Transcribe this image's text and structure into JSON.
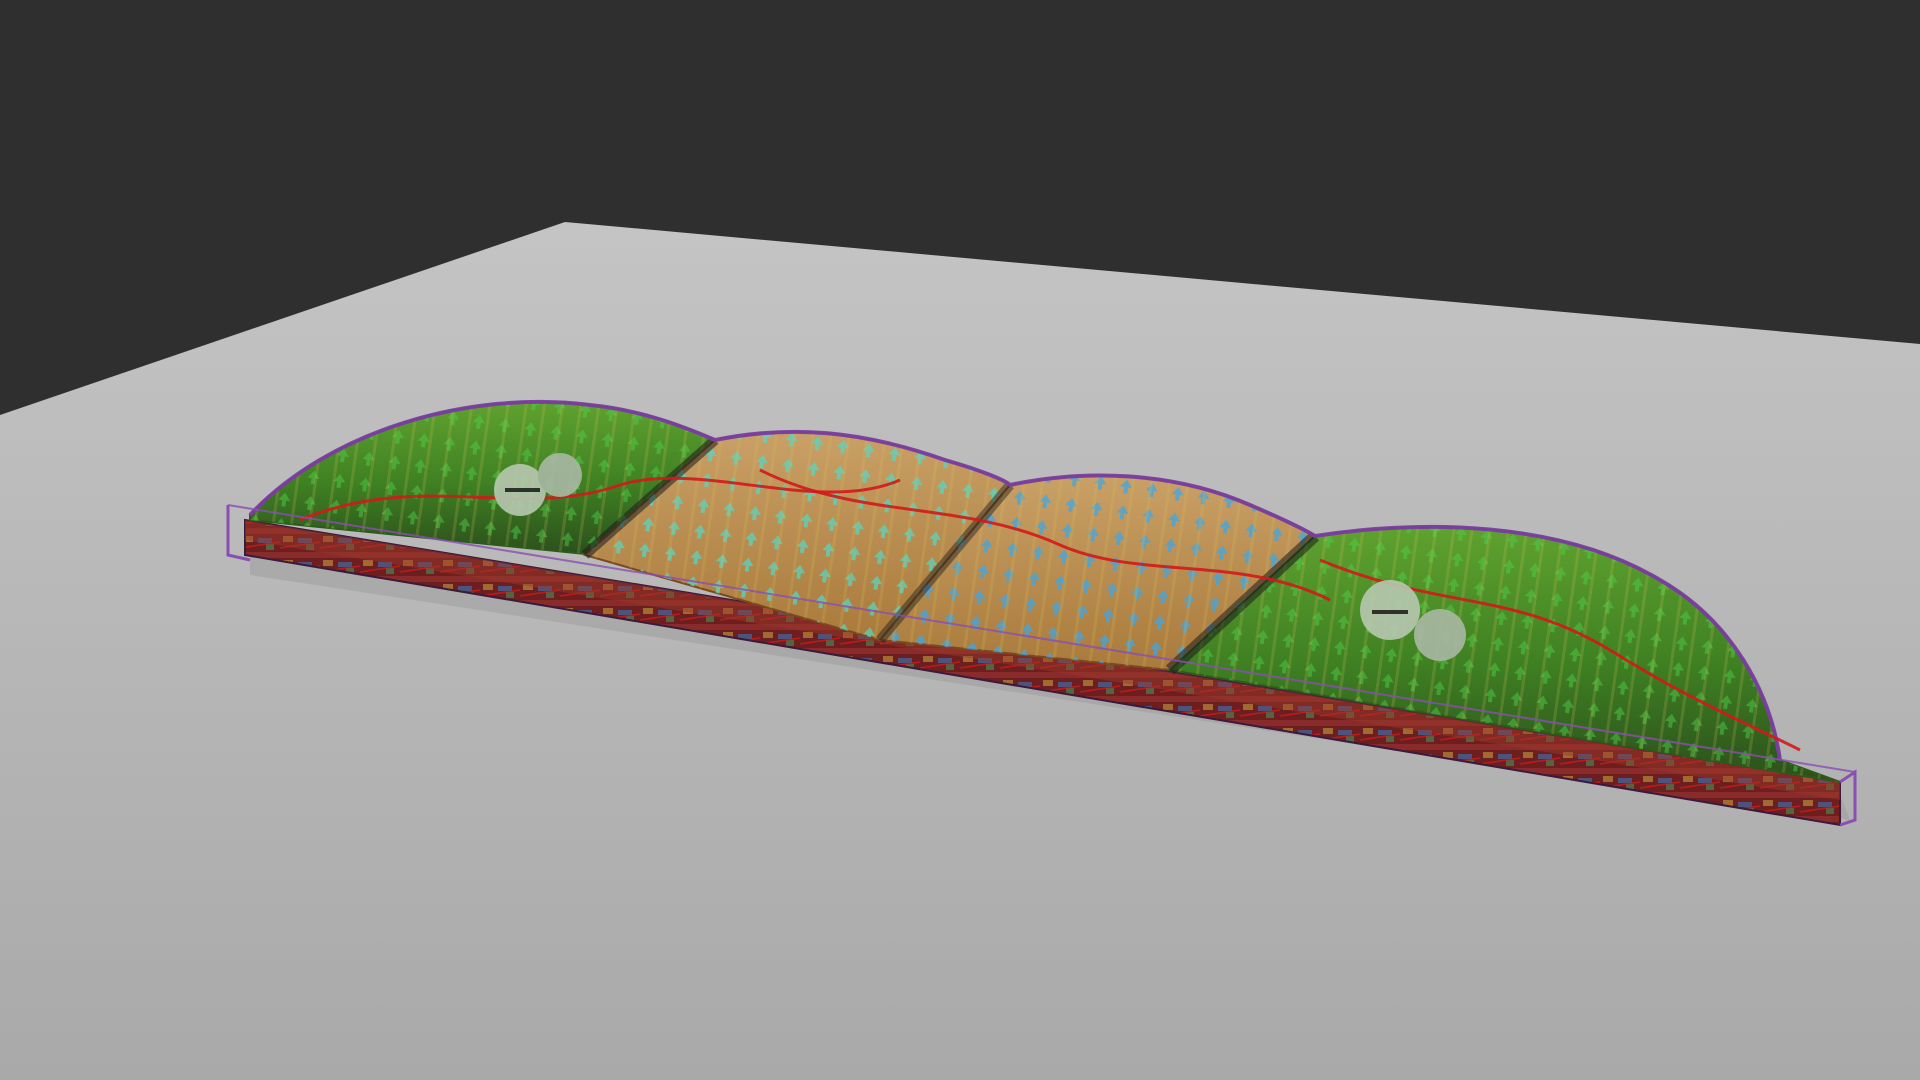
{
  "scene": {
    "background_color": "#2f2f2f",
    "ground_color": "#b3b3b3",
    "object": {
      "description_visible": false,
      "segments": 4,
      "panel_colors": {
        "green_panel": "#4f9a2a",
        "tan_panel": "#c79a5b",
        "teal_arrows": "#57d6c2",
        "blue_arrows": "#3da7e6",
        "green_arrows": "#4fd14a",
        "rim_purple": "#7a3ea0",
        "red_wire": "#d11a1a",
        "dark_stripe": "#1d1d1d"
      },
      "frame_color": "#8a4fb3"
    }
  }
}
